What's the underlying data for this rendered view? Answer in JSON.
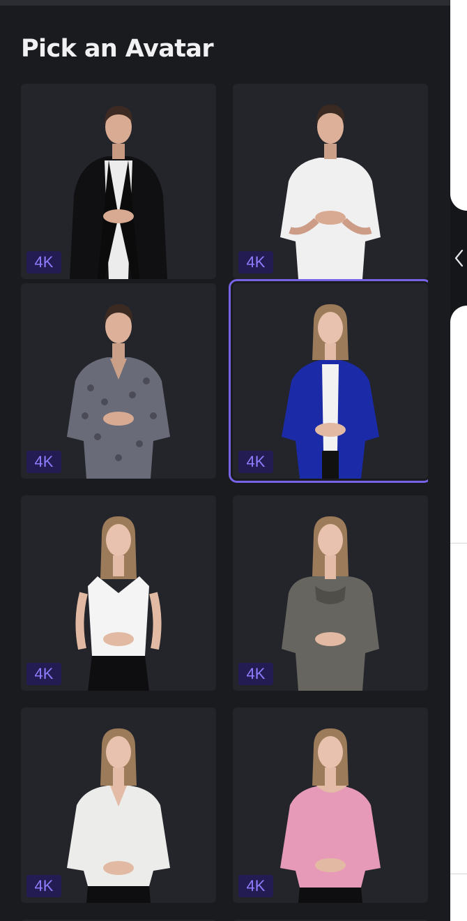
{
  "header": {
    "title": "Pick an Avatar"
  },
  "badge_label": "4K",
  "colors": {
    "accent": "#7663e6",
    "badge_bg": "#221c52",
    "badge_text": "#8f7dff",
    "panel_bg": "#1a1b1f",
    "card_bg": "#24252a"
  },
  "avatars": [
    {
      "id": 1,
      "badge": "4K",
      "selected": false
    },
    {
      "id": 2,
      "badge": "4K",
      "selected": false
    },
    {
      "id": 3,
      "badge": "4K",
      "selected": false
    },
    {
      "id": 4,
      "badge": "4K",
      "selected": true
    },
    {
      "id": 5,
      "badge": "4K",
      "selected": false
    },
    {
      "id": 6,
      "badge": "4K",
      "selected": false
    },
    {
      "id": 7,
      "badge": "4K",
      "selected": false
    },
    {
      "id": 8,
      "badge": "4K",
      "selected": false
    }
  ],
  "icons": {
    "collapse": "chevron-left-icon"
  }
}
